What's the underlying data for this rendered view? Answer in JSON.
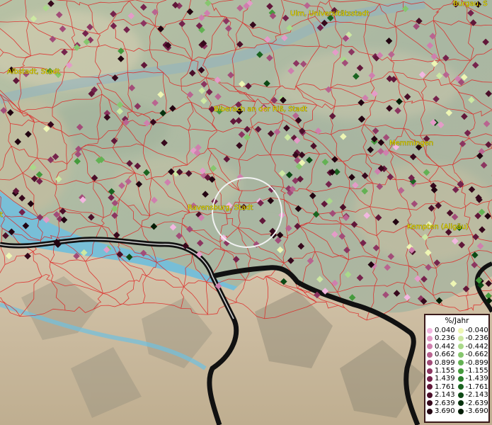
{
  "map": {
    "cities": [
      {
        "name": "Ulm, Universitätsstadt"
      },
      {
        "name": "Burgau, S"
      },
      {
        "name": "Albstadt, Stadt"
      },
      {
        "name": "Biberach an der Riß, Stadt"
      },
      {
        "name": "Memmingen"
      },
      {
        "name": "Ravensburg, Stadt"
      },
      {
        "name": "Kempten (Allgäu)"
      },
      {
        "name": "t"
      }
    ]
  },
  "legend": {
    "title": "%/Jahr",
    "positive": [
      {
        "label": "0.040",
        "color": "#f2b7e0"
      },
      {
        "label": "0.236",
        "color": "#e49bc8"
      },
      {
        "label": "0.442",
        "color": "#cf7fae"
      },
      {
        "label": "0.662",
        "color": "#b96490"
      },
      {
        "label": "0.899",
        "color": "#a24c78"
      },
      {
        "label": "1.155",
        "color": "#8c3560"
      },
      {
        "label": "1.439",
        "color": "#75234c"
      },
      {
        "label": "1.761",
        "color": "#611739"
      },
      {
        "label": "2.143",
        "color": "#4b0f29"
      },
      {
        "label": "2.639",
        "color": "#36081c"
      },
      {
        "label": "3.690",
        "color": "#220411"
      }
    ],
    "negative": [
      {
        "label": "-0.040",
        "color": "#eef6b4"
      },
      {
        "label": "-0.236",
        "color": "#cde8a2"
      },
      {
        "label": "-0.442",
        "color": "#aad98a"
      },
      {
        "label": "-0.662",
        "color": "#86c66e"
      },
      {
        "label": "-0.899",
        "color": "#63b153"
      },
      {
        "label": "-1.155",
        "color": "#449a3c"
      },
      {
        "label": "-1.439",
        "color": "#2c7f2c"
      },
      {
        "label": "-1.761",
        "color": "#1a6420"
      },
      {
        "label": "-2.143",
        "color": "#0d4915"
      },
      {
        "label": "-2.639",
        "color": "#06310d"
      },
      {
        "label": "-3.690",
        "color": "#021c06"
      }
    ]
  }
}
